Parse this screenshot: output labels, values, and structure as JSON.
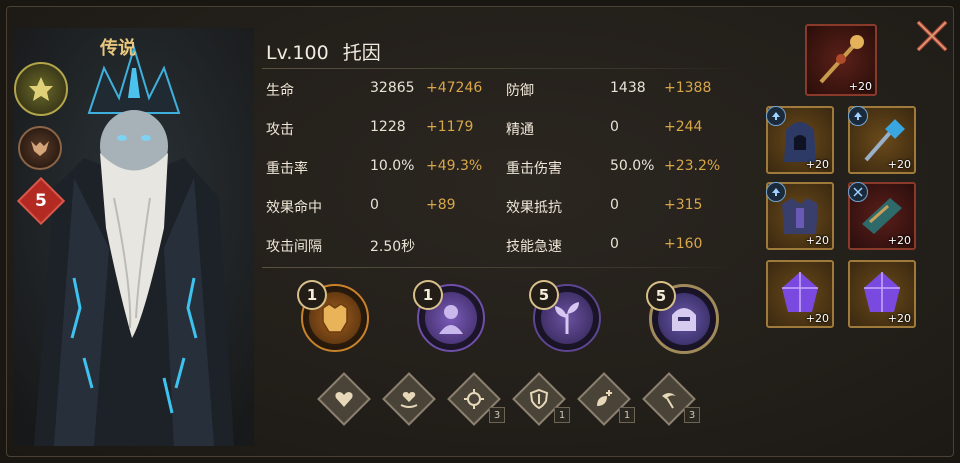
{
  "hero": {
    "rarity": "传说",
    "level": "Lv.100",
    "name": "托因",
    "star_badge": "5"
  },
  "stats": [
    {
      "label": "生命",
      "value": "32865",
      "bonus": "+47246",
      "label2": "防御",
      "value2": "1438",
      "bonus2": "+1388"
    },
    {
      "label": "攻击",
      "value": "1228",
      "bonus": "+1179",
      "label2": "精通",
      "value2": "0",
      "bonus2": "+244"
    },
    {
      "label": "重击率",
      "value": "10.0%",
      "bonus": "+49.3%",
      "label2": "重击伤害",
      "value2": "50.0%",
      "bonus2": "+23.2%"
    },
    {
      "label": "效果命中",
      "value": "0",
      "bonus": "+89",
      "label2": "效果抵抗",
      "value2": "0",
      "bonus2": "+315"
    },
    {
      "label": "攻击间隔",
      "value": "2.50秒",
      "bonus": "",
      "label2": "技能急速",
      "value2": "0",
      "bonus2": "+160"
    }
  ],
  "skills": [
    {
      "level": "1",
      "icon": "armor-icon",
      "color": "#c9822a"
    },
    {
      "level": "1",
      "icon": "spirit-icon",
      "color": "#6e4fa8"
    },
    {
      "level": "5",
      "icon": "sprout-icon",
      "color": "#5d4690"
    },
    {
      "level": "5",
      "icon": "helmet-icon",
      "color": "#5a4a9a"
    }
  ],
  "talents": [
    {
      "icon": "heart-icon",
      "count": ""
    },
    {
      "icon": "heart-hand-icon",
      "count": ""
    },
    {
      "icon": "crosshair-icon",
      "count": "3"
    },
    {
      "icon": "shield-icon",
      "count": "1"
    },
    {
      "icon": "leaf-plus-icon",
      "count": "1"
    },
    {
      "icon": "sickle-icon",
      "count": "3"
    }
  ],
  "equipment": {
    "weapon": {
      "plus": "+20",
      "icon": "staff-icon"
    },
    "slots": [
      {
        "plus": "+20",
        "icon": "hood-icon"
      },
      {
        "plus": "+20",
        "icon": "scepter-icon"
      },
      {
        "plus": "+20",
        "icon": "chestplate-icon"
      },
      {
        "plus": "+20",
        "icon": "bracer-icon"
      },
      {
        "plus": "+20",
        "icon": "crystal-icon"
      },
      {
        "plus": "+20",
        "icon": "crystal-icon"
      }
    ]
  }
}
